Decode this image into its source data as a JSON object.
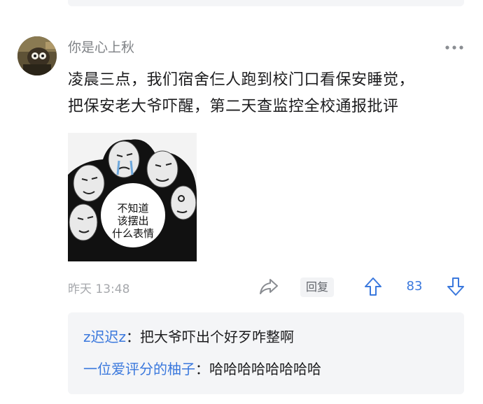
{
  "user": {
    "name": "你是心上秋",
    "avatar": "user-avatar"
  },
  "comment": {
    "line1": "凌晨三点，我们宿舍仨人跑到校门口看保安睡觉，",
    "line2": "把保安老大爷吓醒，第二天查监控全校通报批评"
  },
  "sticker": {
    "text_line1": "不知道",
    "text_line2": "该摆出",
    "text_line3": "什么表情"
  },
  "meta": {
    "timestamp": "昨天 13:48",
    "reply_label": "回复",
    "vote_count": "83",
    "icons": [
      "share-icon",
      "upvote-icon",
      "downvote-icon",
      "more-icon"
    ]
  },
  "replies": [
    {
      "author": "z迟迟z",
      "separator": "：",
      "text": "把大爷吓出个好歹咋整啊"
    },
    {
      "author": "一位爱评分的柚子",
      "separator": "：",
      "text": "哈哈哈哈哈哈哈哈"
    }
  ],
  "colors": {
    "accent": "#3a78dd",
    "meta_gray": "#a6a8ac",
    "reply_bg": "#f4f5f7",
    "text": "#1c1c1e"
  }
}
